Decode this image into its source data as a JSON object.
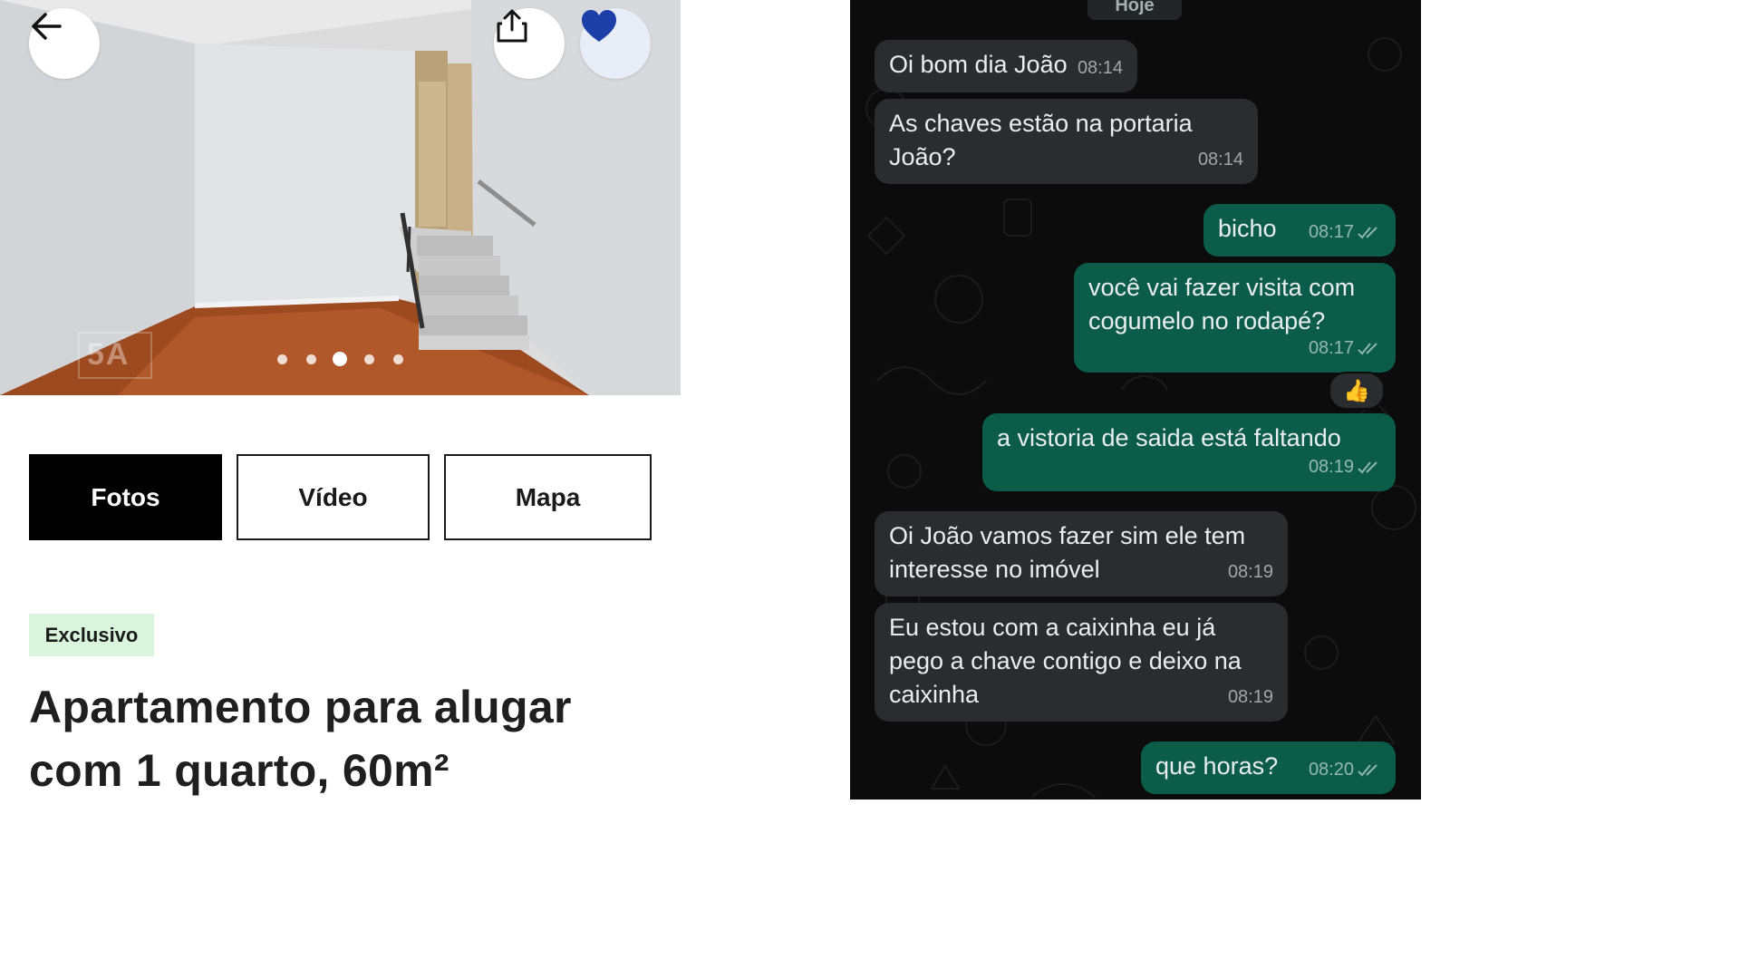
{
  "listing": {
    "photo": {
      "slide_index": 3,
      "slide_count": 5,
      "watermark": "5A"
    },
    "buttons": {
      "back_icon": "arrow-left-icon",
      "share_icon": "share-icon",
      "favorite_icon": "heart-icon",
      "favorite_color": "#1d3fa8"
    },
    "tabs": [
      {
        "label": "Fotos",
        "active": true
      },
      {
        "label": "Vídeo",
        "active": false
      },
      {
        "label": "Mapa",
        "active": false
      }
    ],
    "badge": "Exclusivo",
    "title_line1": "Apartamento para alugar",
    "title_line2": "com 1 quarto, 60m²"
  },
  "chat": {
    "date_separator": "Hoje",
    "messages": [
      {
        "direction": "in",
        "text": "Oi bom dia João",
        "time": "08:14"
      },
      {
        "direction": "in",
        "text_line1": "As chaves estão na portaria",
        "text_line2": "João?",
        "time": "08:14"
      },
      {
        "direction": "out",
        "text": "bicho",
        "time": "08:17",
        "read": true
      },
      {
        "direction": "out",
        "text_line1": "você vai fazer visita com",
        "text_line2": "cogumelo no rodapé?",
        "time": "08:17",
        "read": true,
        "reaction": "👍"
      },
      {
        "direction": "out",
        "text": "a vistoria de saida está faltando",
        "time": "08:19",
        "read": true
      },
      {
        "direction": "in",
        "text_line1": "Oi João vamos fazer sim ele tem",
        "text_line2": "interesse no imóvel",
        "time": "08:19"
      },
      {
        "direction": "in",
        "text_line1": "Eu estou com a caixinha eu já",
        "text_line2": "pego a chave contigo e deixo na",
        "text_line3": "caixinha",
        "time": "08:19"
      },
      {
        "direction": "out",
        "text": "que horas?",
        "time": "08:20",
        "read": true
      }
    ],
    "colors": {
      "background": "#0c0c0c",
      "incoming_bubble": "#2a2d2f",
      "outgoing_bubble": "#0b5d4a"
    }
  }
}
